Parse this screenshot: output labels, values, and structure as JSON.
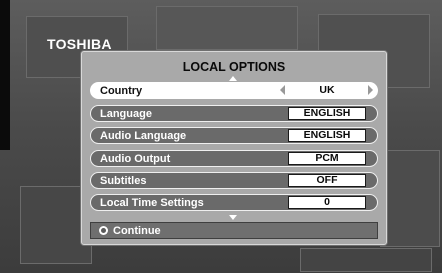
{
  "brand": {
    "logo_text": "TOSHIBA"
  },
  "menu": {
    "title": "LOCAL OPTIONS",
    "items": [
      {
        "label": "Country",
        "value": "UK",
        "selected": true
      },
      {
        "label": "Language",
        "value": "ENGLISH",
        "selected": false
      },
      {
        "label": "Audio Language",
        "value": "ENGLISH",
        "selected": false
      },
      {
        "label": "Audio Output",
        "value": "PCM",
        "selected": false
      },
      {
        "label": "Subtitles",
        "value": "OFF",
        "selected": false
      },
      {
        "label": "Local Time Settings",
        "value": "0",
        "selected": false
      }
    ],
    "footer": {
      "continue_label": "Continue"
    }
  },
  "colors": {
    "background": "#4a4a4a",
    "panel": "#a9a9a9",
    "row": "#6a6a6a",
    "row_selected": "#ffffff"
  },
  "icons": {
    "scroll_up": "triangle-up-icon",
    "scroll_down": "triangle-down-icon",
    "value_left": "chevron-left-icon",
    "value_right": "chevron-right-icon",
    "continue": "circle-button-icon"
  }
}
